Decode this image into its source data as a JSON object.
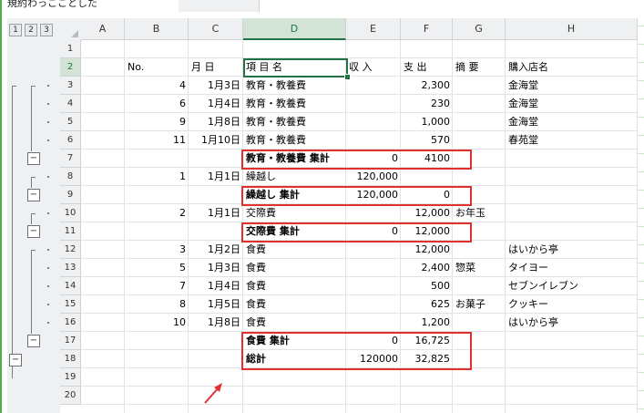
{
  "top_note": "規約わっこことした",
  "outline_levels": [
    "1",
    "2",
    "3"
  ],
  "columns": [
    "A",
    "B",
    "C",
    "D",
    "E",
    "F",
    "G",
    "H"
  ],
  "selected_column": "D",
  "row_numbers": [
    "1",
    "2",
    "3",
    "4",
    "5",
    "6",
    "7",
    "8",
    "9",
    "10",
    "11",
    "12",
    "13",
    "14",
    "15",
    "16",
    "17",
    "18",
    "19",
    "20"
  ],
  "selected_row": "2",
  "header": {
    "no": "No.",
    "date": "月 日",
    "item": "項 目 名",
    "income": "収 入",
    "expense": "支 出",
    "memo": "摘 要",
    "shop": "購入店名"
  },
  "rows": [
    {
      "row": "3",
      "no": "4",
      "date": "1月3日",
      "item": "教育・教養費",
      "income": "",
      "expense": "2,300",
      "memo": "",
      "shop": "金海堂",
      "bold": false
    },
    {
      "row": "4",
      "no": "6",
      "date": "1月4日",
      "item": "教育・教養費",
      "income": "",
      "expense": "230",
      "memo": "",
      "shop": "金海堂",
      "bold": false
    },
    {
      "row": "5",
      "no": "9",
      "date": "1月8日",
      "item": "教育・教養費",
      "income": "",
      "expense": "1,000",
      "memo": "",
      "shop": "金海堂",
      "bold": false
    },
    {
      "row": "6",
      "no": "11",
      "date": "1月10日",
      "item": "教育・教養費",
      "income": "",
      "expense": "570",
      "memo": "",
      "shop": "春苑堂",
      "bold": false
    },
    {
      "row": "7",
      "no": "",
      "date": "",
      "item": "教育・教養費 集計",
      "income": "0",
      "expense": "4100",
      "memo": "",
      "shop": "",
      "bold": true
    },
    {
      "row": "8",
      "no": "1",
      "date": "1月1日",
      "item": "繰越し",
      "income": "120,000",
      "expense": "",
      "memo": "",
      "shop": "",
      "bold": false
    },
    {
      "row": "9",
      "no": "",
      "date": "",
      "item": "繰越し 集計",
      "income": "120,000",
      "expense": "0",
      "memo": "",
      "shop": "",
      "bold": true
    },
    {
      "row": "10",
      "no": "2",
      "date": "1月1日",
      "item": "交際費",
      "income": "",
      "expense": "12,000",
      "memo": "お年玉",
      "shop": "",
      "bold": false
    },
    {
      "row": "11",
      "no": "",
      "date": "",
      "item": "交際費 集計",
      "income": "0",
      "expense": "12,000",
      "memo": "",
      "shop": "",
      "bold": true
    },
    {
      "row": "12",
      "no": "3",
      "date": "1月2日",
      "item": "食費",
      "income": "",
      "expense": "12,000",
      "memo": "",
      "shop": "はいから亭",
      "bold": false
    },
    {
      "row": "13",
      "no": "5",
      "date": "1月3日",
      "item": "食費",
      "income": "",
      "expense": "2,400",
      "memo": "惣菜",
      "shop": "タイヨー",
      "bold": false
    },
    {
      "row": "14",
      "no": "7",
      "date": "1月4日",
      "item": "食費",
      "income": "",
      "expense": "500",
      "memo": "",
      "shop": "セブンイレブン",
      "bold": false
    },
    {
      "row": "15",
      "no": "8",
      "date": "1月5日",
      "item": "食費",
      "income": "",
      "expense": "625",
      "memo": "お菓子",
      "shop": "クッキー",
      "bold": false
    },
    {
      "row": "16",
      "no": "10",
      "date": "1月8日",
      "item": "食費",
      "income": "",
      "expense": "1,200",
      "memo": "",
      "shop": "はいから亭",
      "bold": false
    },
    {
      "row": "17",
      "no": "",
      "date": "",
      "item": "食費 集計",
      "income": "0",
      "expense": "16,725",
      "memo": "",
      "shop": "",
      "bold": true
    },
    {
      "row": "18",
      "no": "",
      "date": "",
      "item": "総計",
      "income": "120000",
      "expense": "32,825",
      "memo": "",
      "shop": "",
      "bold": true
    }
  ],
  "outline_collapse_symbol": "−",
  "colors": {
    "accent": "#217346",
    "highlight_box": "#e03030",
    "arrow": "#e03030"
  },
  "icons": {
    "arrow": "red-arrow-icon",
    "select_all": "select-all-triangle-icon"
  }
}
